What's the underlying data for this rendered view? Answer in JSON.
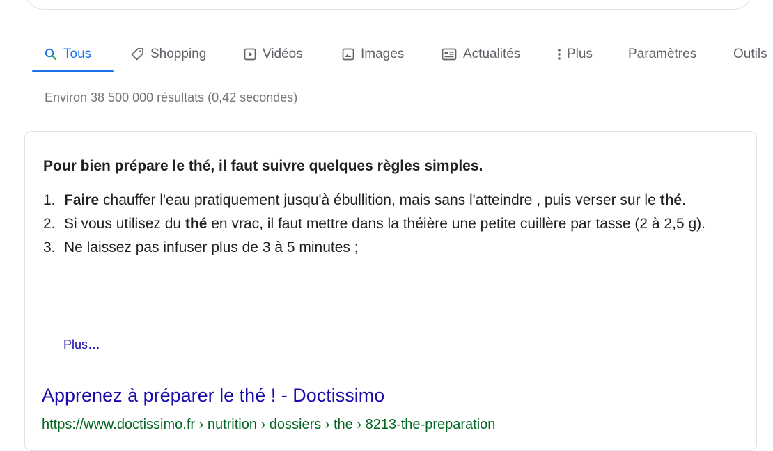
{
  "tabs": [
    {
      "label": "Tous",
      "icon": "search-icon",
      "active": true
    },
    {
      "label": "Shopping",
      "icon": "tag-icon"
    },
    {
      "label": "Vidéos",
      "icon": "video-icon"
    },
    {
      "label": "Images",
      "icon": "image-icon"
    },
    {
      "label": "Actualités",
      "icon": "news-icon"
    },
    {
      "label": "Plus",
      "icon": "more-vert-icon"
    },
    {
      "label": "Paramètres"
    },
    {
      "label": "Outils"
    }
  ],
  "result_stats": "Environ 38 500 000 résultats (0,42 secondes)",
  "snippet": {
    "heading": "Pour bien prépare le thé, il faut suivre quelques règles simples.",
    "steps": [
      {
        "num": "1.",
        "b1": "Faire",
        "t1": " chauffer l'eau pratiquement jusqu'à ébullition, mais sans l'atteindre , puis verser sur le ",
        "b2": "thé",
        "t2": "."
      },
      {
        "num": "2.",
        "t0": "Si vous utilisez du ",
        "b1": "thé",
        "t1": " en vrac, il faut mettre dans la théière une petite cuillère par tasse (2 à 2,5 g)."
      },
      {
        "num": "3.",
        "t0": "Ne laissez pas infuser plus de 3 à 5 minutes ;"
      }
    ],
    "more_label": "Plus…"
  },
  "result": {
    "title": "Apprenez à préparer le thé ! - Doctissimo",
    "url": "https://www.doctissimo.fr › nutrition › dossiers › the › 8213-the-preparation"
  },
  "colors": {
    "accent": "#1a73e8",
    "link": "#1a0dab",
    "url": "#006621",
    "muted": "#5f6368"
  }
}
